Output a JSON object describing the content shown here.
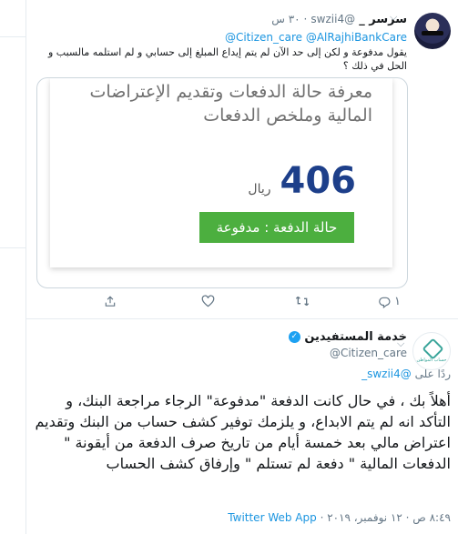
{
  "tweet1": {
    "name": "سرسر _",
    "handle": "@swzii4",
    "time": "٣٠ س",
    "reply_to": "@Citizen_care @AlRajhiBankCare",
    "text": "يقول مدفوعة و لكن إلى حد الآن لم يتم إيداع المبلغ إلى حسابي و لم استلمه مالسبب و الحل في ذلك ؟",
    "card": {
      "title": "معرفة حالة الدفعات وتقديم الإعتراضات المالية وملخص الدفعات",
      "amount": "406",
      "currency": "ريال",
      "status_label": "حالة الدفعة : مدفوعة"
    },
    "reply_count": "١"
  },
  "tweet2": {
    "name": "خدمة المستفيدين",
    "handle": "@Citizen_care",
    "avatar_text": "حساب المواطن",
    "replying_label": "ردًا على",
    "replying_handle": "@swzii4_",
    "text": "أهلاً بك ، في حال كانت الدفعة \"مدفوعة\" الرجاء مراجعة البنك، و التأكد انه لم يتم الابداع، و يلزمك توفير كشف حساب من البنك وتقديم اعتراض مالي بعد خمسة أيام من تاريخ صرف الدفعة من أيقونة \" الدفعات المالية \" دفعة لم تستلم \" وإرفاق كشف الحساب",
    "timestamp": "٨:٤٩ ص · ١٢ نوفمبر، ٢٠١٩ ·",
    "source": "Twitter Web App"
  },
  "icons": {
    "reply": "reply-icon",
    "retweet": "retweet-icon",
    "like": "heart-icon",
    "share": "share-icon",
    "verified": "verified-badge-icon",
    "caret": "chevron-down-icon"
  }
}
